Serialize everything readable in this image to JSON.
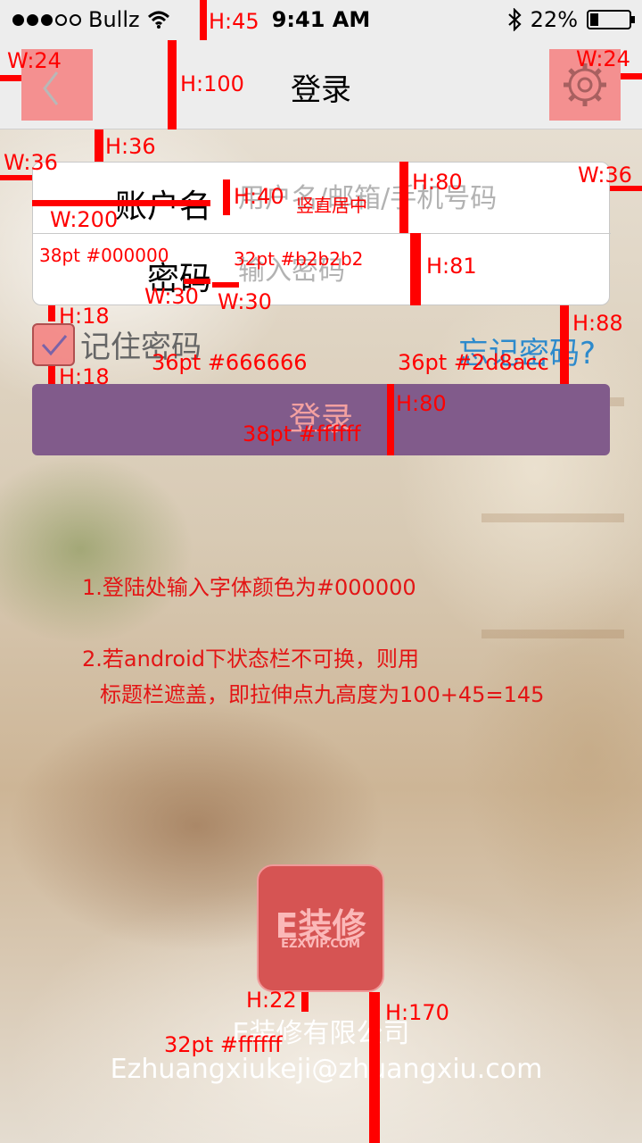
{
  "status_bar": {
    "carrier": "Bullz",
    "time": "9:41 AM",
    "battery_text": "22%",
    "battery_level": 0.22,
    "icons": [
      "signal-dots-icon",
      "wifi-icon",
      "bluetooth-icon",
      "battery-icon"
    ]
  },
  "title_bar": {
    "title": "登录",
    "back_icon": "chevron-left-icon",
    "settings_icon": "gear-icon"
  },
  "form": {
    "account_label": "账户名",
    "account_placeholder": "用户名/邮箱/手机号码",
    "password_label": "密码",
    "password_placeholder": "输入密码"
  },
  "remember": {
    "label": "记住密码",
    "checked": true
  },
  "forgot_link": "忘记密码?",
  "login_button": "登录",
  "notes": {
    "line1": "1.登陆处输入字体颜色为#000000",
    "line2": "2.若android下状态栏不可换，则用",
    "line3": "标题栏遮盖，即拉伸点九高度为100+45=145"
  },
  "annotations": {
    "h45": "H:45",
    "w24_left": "W:24",
    "w24_right": "W:24",
    "h100": "H:100",
    "h36": "H:36",
    "w36_left": "W:36",
    "w36_right": "W:36",
    "h40": "H:40",
    "v_center": "竖直居中",
    "h80_card": "H:80",
    "w200": "W:200",
    "label_spec": "38pt #000000",
    "input_spec": "32pt #b2b2b2",
    "h81": "H:81",
    "w30_a": "W:30",
    "w30_b": "W:30",
    "h18_a": "H:18",
    "h18_b": "H:18",
    "remember_spec": "36pt #666666",
    "forgot_spec": "36pt #2d8acc",
    "h88": "H:88",
    "h80_btn": "H:80",
    "btn_spec": "38pt #ffffff",
    "h22": "H:22",
    "h170": "H:170",
    "footer_spec": "32pt #ffffff"
  },
  "logo": {
    "text": "E装修",
    "subtext": "EZXVIP.COM"
  },
  "footer": {
    "company": "E装修有限公司",
    "email": "Ezhuangxiukeji@zhuangxiu.com"
  },
  "colors": {
    "label": "#000000",
    "placeholder": "#b2b2b2",
    "remember": "#666666",
    "forgot": "#2d8acc",
    "button_bg": "#815b8b",
    "footer_text": "#ffffff",
    "annotation": "#ff0000"
  }
}
